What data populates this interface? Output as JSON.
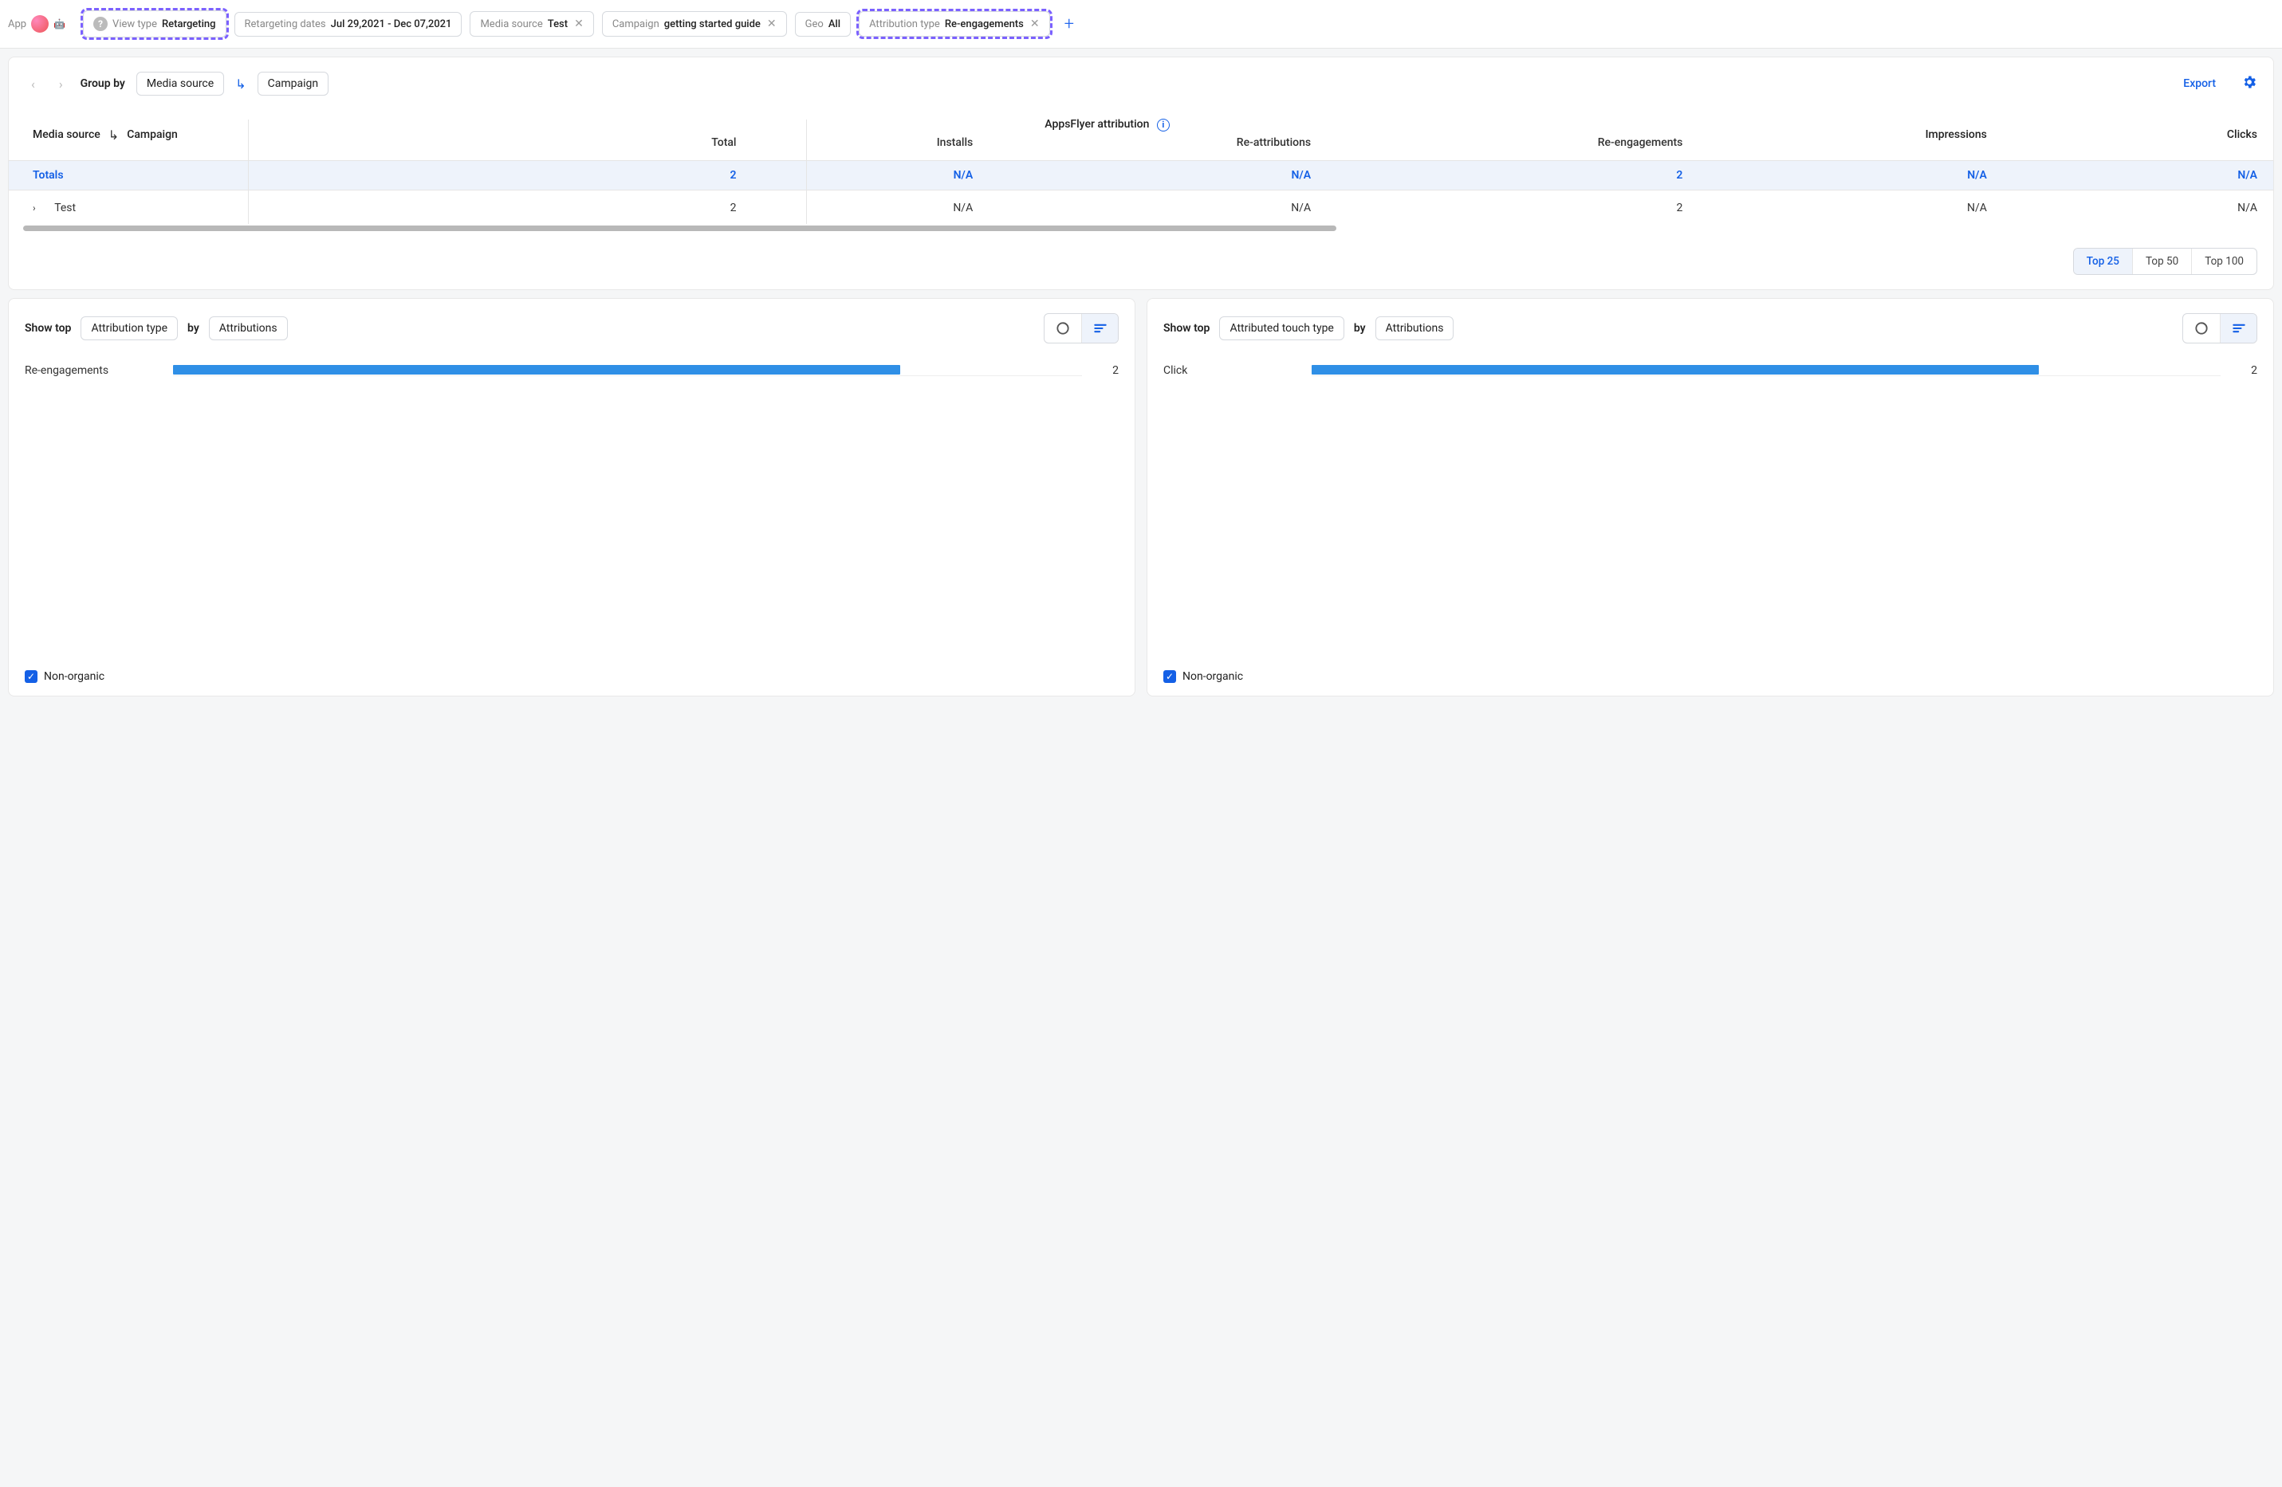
{
  "filters": {
    "app_label": "App",
    "view_type": {
      "label": "View type",
      "value": "Retargeting"
    },
    "dates": {
      "label": "Retargeting dates",
      "value": "Jul 29,2021 - Dec 07,2021"
    },
    "media_source": {
      "label": "Media source",
      "value": "Test"
    },
    "campaign": {
      "label": "Campaign",
      "value": "getting started guide"
    },
    "geo": {
      "label": "Geo",
      "value": "All"
    },
    "attr_type": {
      "label": "Attribution type",
      "value": "Re-engagements"
    }
  },
  "groupby": {
    "label": "Group by",
    "level1": "Media source",
    "level2": "Campaign"
  },
  "actions": {
    "export": "Export"
  },
  "table": {
    "first_col": {
      "a": "Media source",
      "b": "Campaign"
    },
    "group_header": "AppsFlyer attribution",
    "cols": {
      "total": "Total",
      "installs": "Installs",
      "reattr": "Re-attributions",
      "reeng": "Re-engagements",
      "impr": "Impressions",
      "clicks": "Clicks"
    },
    "totals_label": "Totals",
    "totals": {
      "total": "2",
      "installs": "N/A",
      "reattr": "N/A",
      "reeng": "2",
      "impr": "N/A",
      "clicks": "N/A"
    },
    "rows": [
      {
        "name": "Test",
        "total": "2",
        "installs": "N/A",
        "reattr": "N/A",
        "reeng": "2",
        "impr": "N/A",
        "clicks": "N/A"
      }
    ],
    "top_options": {
      "t25": "Top 25",
      "t50": "Top 50",
      "t100": "Top 100"
    }
  },
  "card_left": {
    "show_top": "Show top",
    "dim": "Attribution type",
    "by": "by",
    "metric": "Attributions",
    "bar_label": "Re-engagements",
    "bar_value": "2",
    "non_organic": "Non-organic"
  },
  "card_right": {
    "show_top": "Show top",
    "dim": "Attributed touch type",
    "by": "by",
    "metric": "Attributions",
    "bar_label": "Click",
    "bar_value": "2",
    "non_organic": "Non-organic"
  },
  "chart_data": [
    {
      "type": "bar",
      "title": "Show top Attribution type by Attributions",
      "categories": [
        "Re-engagements"
      ],
      "values": [
        2
      ],
      "xlabel": "",
      "ylabel": "Attributions"
    },
    {
      "type": "bar",
      "title": "Show top Attributed touch type by Attributions",
      "categories": [
        "Click"
      ],
      "values": [
        2
      ],
      "xlabel": "",
      "ylabel": "Attributions"
    }
  ]
}
